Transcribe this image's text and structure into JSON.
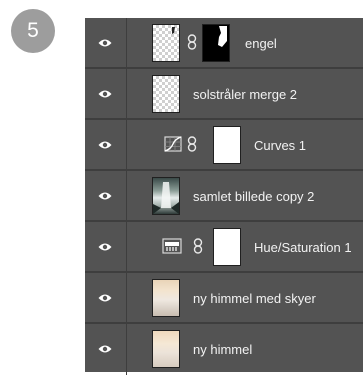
{
  "step_number": "5",
  "colors": {
    "panel_bg": "#535353",
    "divider": "#3e3e3e",
    "text": "#f2f2f2",
    "badge": "#9d9d9d"
  },
  "layers": [
    {
      "name": "engel",
      "visible": true,
      "kind": "pixel-with-mask",
      "thumb": "transparent-checker",
      "mask": "black-with-white-figure"
    },
    {
      "name": "solstråler merge 2",
      "visible": true,
      "kind": "pixel",
      "thumb": "transparent-checker"
    },
    {
      "name": "Curves 1",
      "visible": true,
      "kind": "adjustment",
      "adjust_icon": "curves-icon",
      "mask": "white"
    },
    {
      "name": "samlet billede copy 2",
      "visible": true,
      "kind": "pixel",
      "thumb": "image-waterfall"
    },
    {
      "name": "Hue/Saturation 1",
      "visible": true,
      "kind": "adjustment",
      "adjust_icon": "hue-saturation-icon",
      "mask": "white"
    },
    {
      "name": "ny himmel med skyer",
      "visible": true,
      "kind": "pixel",
      "thumb": "image-sky-clouds"
    },
    {
      "name": "ny himmel",
      "visible": true,
      "kind": "pixel",
      "thumb": "image-sky"
    }
  ]
}
